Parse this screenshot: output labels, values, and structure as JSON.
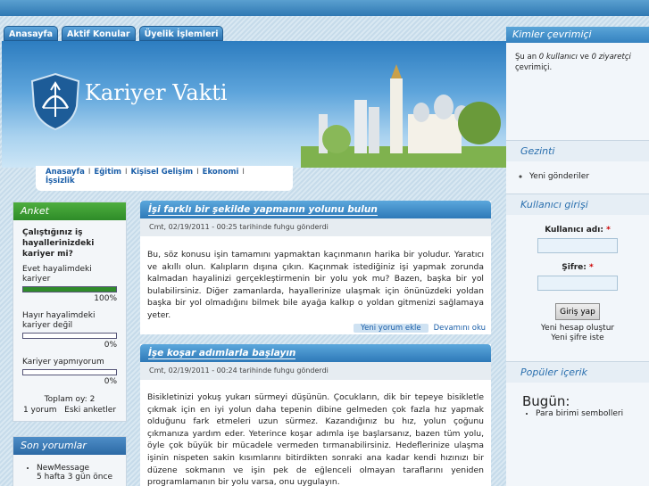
{
  "primary_tabs": [
    "Anasayfa",
    "Aktif Konular",
    "Üyelik İşlemleri"
  ],
  "site": {
    "name": "Kariyer Vakti"
  },
  "secondary_nav": [
    "Anasayfa",
    "Eğitim",
    "Kişisel Gelişim",
    "Ekonomi",
    "İşsizlik"
  ],
  "poll": {
    "title": "Anket",
    "question": "Çalıştığınız iş hayallerinizdeki kariyer mi?",
    "options": [
      {
        "label": "Evet hayalimdeki kariyer",
        "percent_text": "100%",
        "value": 1.0
      },
      {
        "label": "Hayır hayalimdeki kariyer değil",
        "percent_text": "0%",
        "value": 0
      },
      {
        "label": "Kariyer yapmıyorum",
        "percent_text": "0%",
        "value": 0
      }
    ],
    "total": "Toplam oy: 2",
    "links": [
      "1 yorum",
      "Eski anketler"
    ]
  },
  "recent_comments": {
    "title": "Son yorumlar",
    "items": [
      {
        "title": "NewMessage",
        "age": "5 hafta 3 gün önce"
      }
    ]
  },
  "nodes": [
    {
      "title": "İşi farklı bir şekilde yapmanın yolunu bulun",
      "meta": "Cmt, 02/19/2011 - 00:25 tarihinde fuhgu gönderdi",
      "body": "Bu, söz konusu işin tamamını yapmaktan kaçınmanın harika bir yoludur. Yaratıcı ve akıllı olun. Kalıpların dışına çıkın. Kaçınmak istediğiniz işi yapmak zorunda kalmadan hayalinizi gerçekleştirmenin bir yolu yok mu? Bazen, başka bir yol bulabilirsiniz. Diğer zamanlarda, hayallerinize ulaşmak için önünüzdeki yoldan başka bir yol olmadığını bilmek bile ayağa kalkıp o yoldan gitmenizi sağlamaya yeter.",
      "links": [
        "Yeni yorum ekle",
        "Devamını oku"
      ]
    },
    {
      "title": "İşe koşar adımlarla başlayın",
      "meta": "Cmt, 02/19/2011 - 00:24 tarihinde fuhgu gönderdi",
      "body": "Bisikletinizi yokuş yukarı sürmeyi düşünün. Çocukların, dik bir tepeye bisikletle çıkmak için en iyi yolun daha tepenin dibine gelmeden çok fazla hız yapmak olduğunu fark etmeleri uzun sürmez. Kazandığınız bu hız, yolun çoğunu çıkmanıza yardım eder. Yeterince koşar adımla işe başlarsanız, bazen tüm yolu, öyle çok büyük bir mücadele vermeden tırmanabilirsiniz. Hedeflerinize ulaşma işinin nispeten sakin kısımlarını bitirdikten sonraki ana kadar kendi hızınızı bir düzene sokmanın ve işin pek de eğlenceli olmayan taraflarını yeniden programlamanın bir yolu varsa, onu uygulayın."
    }
  ],
  "right": {
    "online_title": "Kimler çevrimiçi",
    "online_text": {
      "pre": "Şu an ",
      "users": "0 kullanıcı",
      "mid": " ve ",
      "guests": "0 ziyaretçi",
      "post": " çevrimiçi."
    },
    "nav_title": "Gezinti",
    "nav_items": [
      "Yeni gönderiler"
    ],
    "login_title": "Kullanıcı girişi",
    "username_label": "Kullanıcı adı:",
    "password_label": "Şifre:",
    "required_mark": "*",
    "login_button": "Giriş yap",
    "register_link": "Yeni hesap oluştur",
    "reset_link": "Yeni şifre iste",
    "popular_title": "Popüler içerik",
    "popular_sub": "Bugün:",
    "popular_items": [
      "Para birimi sembolleri"
    ]
  }
}
